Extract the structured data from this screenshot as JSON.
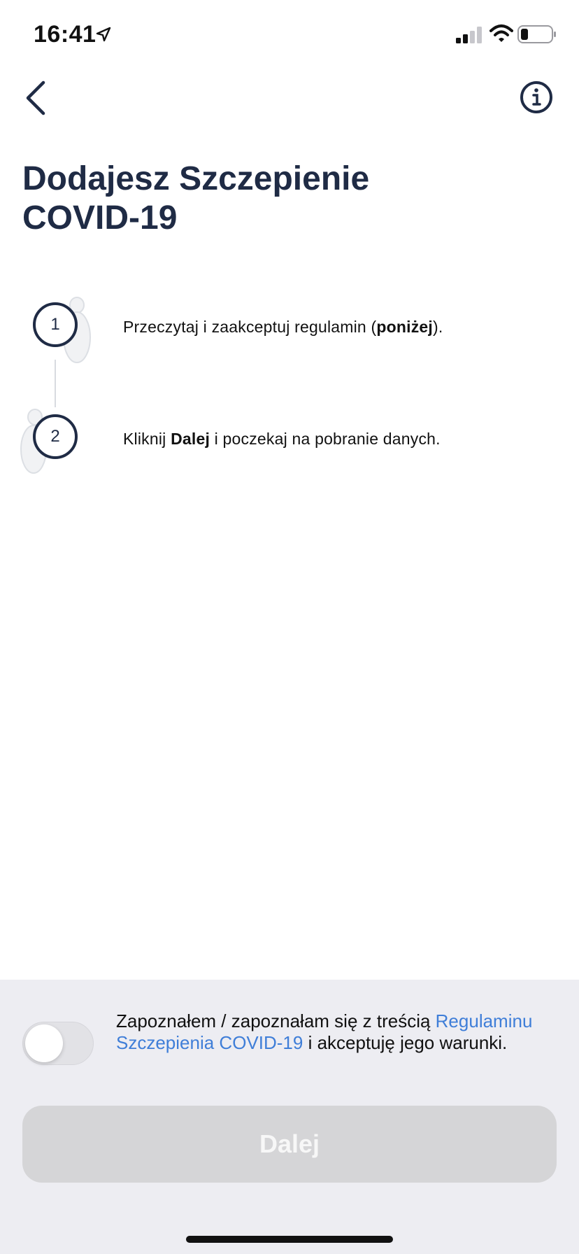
{
  "status_bar": {
    "time": "16:41",
    "icons": [
      "location-arrow-icon",
      "cellular-signal-icon",
      "wifi-icon",
      "battery-icon"
    ]
  },
  "nav": {
    "back_icon": "chevron-left-icon",
    "info_icon": "info-circle-icon"
  },
  "title": {
    "line1": "Dodajesz Szczepienie",
    "line2": "COVID-19"
  },
  "steps": [
    {
      "number": "1",
      "text_before": "Przeczytaj i zaakceptuj regulamin (",
      "text_bold": "poniżej",
      "text_after": ")."
    },
    {
      "number": "2",
      "text_before": "Kliknij ",
      "text_bold": "Dalej",
      "text_after": " i poczekaj na pobranie danych."
    }
  ],
  "consent": {
    "toggle_state": "off",
    "text_before": "Zapoznałem / zapoznałam się z treścią ",
    "link_text": "Regulaminu Szczepienia COVID-19",
    "text_after": " i akceptuję jego warunki."
  },
  "next_button": {
    "label": "Dalej",
    "enabled": false
  },
  "colors": {
    "primary_text": "#1f2b45",
    "link": "#3f7ed8",
    "panel_bg": "#ededf2",
    "button_disabled": "#d5d5d7"
  }
}
